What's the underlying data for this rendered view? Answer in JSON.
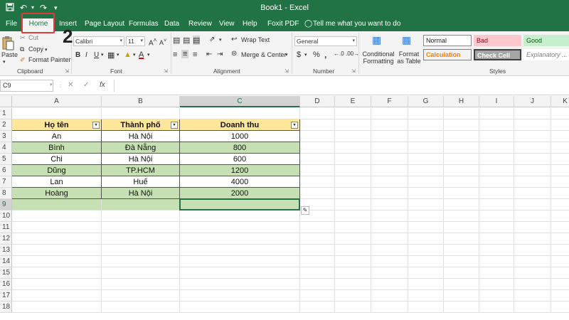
{
  "title_bar": {
    "title": "Book1  -  Excel",
    "save_icon": "save-icon",
    "undo_icon": "undo-icon",
    "customize_icon": "customize-icon"
  },
  "tabs": [
    "File",
    "Home",
    "Insert",
    "Page Layout",
    "Formulas",
    "Data",
    "Review",
    "View",
    "Help",
    "Foxit PDF"
  ],
  "tell_me": "Tell me what you want to do",
  "annotation_number": "2",
  "clipboard": {
    "paste": "Paste",
    "cut": "Cut",
    "copy": "Copy",
    "format_painter": "Format Painter",
    "label": "Clipboard"
  },
  "font": {
    "name": "Calibri",
    "size": "11",
    "label": "Font",
    "bold": "B",
    "italic": "I",
    "underline": "U"
  },
  "alignment": {
    "wrap": "Wrap Text",
    "merge": "Merge & Center",
    "label": "Alignment"
  },
  "number": {
    "format": "General",
    "currency": "$",
    "percent": "%",
    "comma": ",",
    "label": "Number"
  },
  "styles": {
    "conditional": "Conditional Formatting",
    "format_table": "Format as Table",
    "label": "Styles",
    "normal": "Normal",
    "bad": "Bad",
    "good": "Good",
    "calculation": "Calculation",
    "check_cell": "Check Cell",
    "explanatory": "Explanatory ..."
  },
  "formula_bar": {
    "name_box": "C9",
    "fx": "fx",
    "value": ""
  },
  "columns": [
    "A",
    "B",
    "C",
    "D",
    "E",
    "F",
    "G",
    "H",
    "I",
    "J",
    "K"
  ],
  "rows": [
    "1",
    "2",
    "3",
    "4",
    "5",
    "6",
    "7",
    "8",
    "9",
    "10",
    "11",
    "12",
    "13",
    "14",
    "15",
    "16",
    "17",
    "18"
  ],
  "table": {
    "headers": [
      "Họ tên",
      "Thành phố",
      "Doanh thu"
    ],
    "rows": [
      [
        "An",
        "Hà Nội",
        "1000"
      ],
      [
        "Bình",
        "Đà Nẵng",
        "800"
      ],
      [
        "Chi",
        "Hà Nội",
        "600"
      ],
      [
        "Dũng",
        "TP.HCM",
        "1200"
      ],
      [
        "Lan",
        "Huế",
        "4000"
      ],
      [
        "Hoàng",
        "Hà Nội",
        "2000"
      ]
    ]
  },
  "colors": {
    "excel_green": "#217346",
    "header_fill": "#ffe699",
    "band_fill": "#c6e0b4",
    "annotation_red": "#e23b3b"
  }
}
